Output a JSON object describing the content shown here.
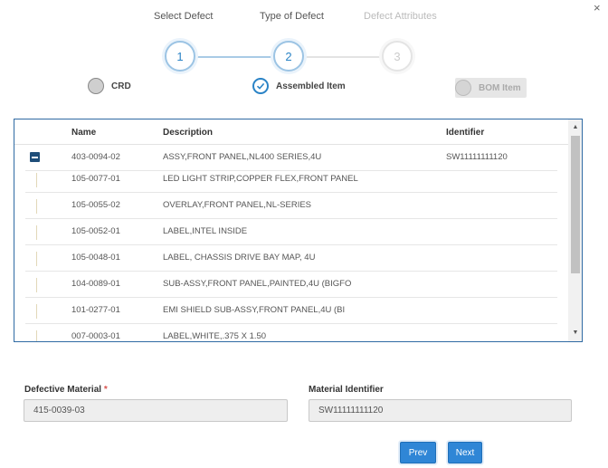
{
  "close_label": "×",
  "wizard": {
    "steps": [
      {
        "label": "Select Defect",
        "number": "1",
        "state": "done"
      },
      {
        "label": "Type of Defect",
        "number": "2",
        "state": "done"
      },
      {
        "label": "Defect Attributes",
        "number": "3",
        "state": "todo"
      }
    ]
  },
  "type_options": [
    {
      "label": "CRD",
      "state": "unselected"
    },
    {
      "label": "Assembled Item",
      "state": "selected"
    },
    {
      "label": "BOM Item",
      "state": "disabled"
    }
  ],
  "table": {
    "columns": [
      "Name",
      "Description",
      "Identifier"
    ],
    "rows": [
      {
        "name": "403-0094-02",
        "description": "ASSY,FRONT PANEL,NL400 SERIES,4U",
        "identifier": "SW11111111120",
        "expandable": true
      },
      {
        "name": "105-0077-01",
        "description": "LED LIGHT STRIP,COPPER FLEX,FRONT PANEL",
        "identifier": ""
      },
      {
        "name": "105-0055-02",
        "description": "OVERLAY,FRONT PANEL,NL-SERIES",
        "identifier": ""
      },
      {
        "name": "105-0052-01",
        "description": "LABEL,INTEL INSIDE",
        "identifier": ""
      },
      {
        "name": "105-0048-01",
        "description": "LABEL, CHASSIS DRIVE BAY MAP, 4U",
        "identifier": ""
      },
      {
        "name": "104-0089-01",
        "description": "SUB-ASSY,FRONT PANEL,PAINTED,4U (BIGFO",
        "identifier": ""
      },
      {
        "name": "101-0277-01",
        "description": "EMI SHIELD SUB-ASSY,FRONT PANEL,4U (BI",
        "identifier": ""
      },
      {
        "name": "007-0003-01",
        "description": "LABEL,WHITE,.375 X 1.50",
        "identifier": ""
      }
    ]
  },
  "form": {
    "defective_material_label": "Defective Material",
    "required_mark": "*",
    "defective_material_value": "415-0039-03",
    "material_identifier_label": "Material Identifier",
    "material_identifier_value": "SW11111111120"
  },
  "buttons": {
    "prev": "Prev",
    "next": "Next"
  },
  "colors": {
    "accent": "#2f86d6",
    "grid_border": "#2f6aa3",
    "required": "#d9534f"
  }
}
